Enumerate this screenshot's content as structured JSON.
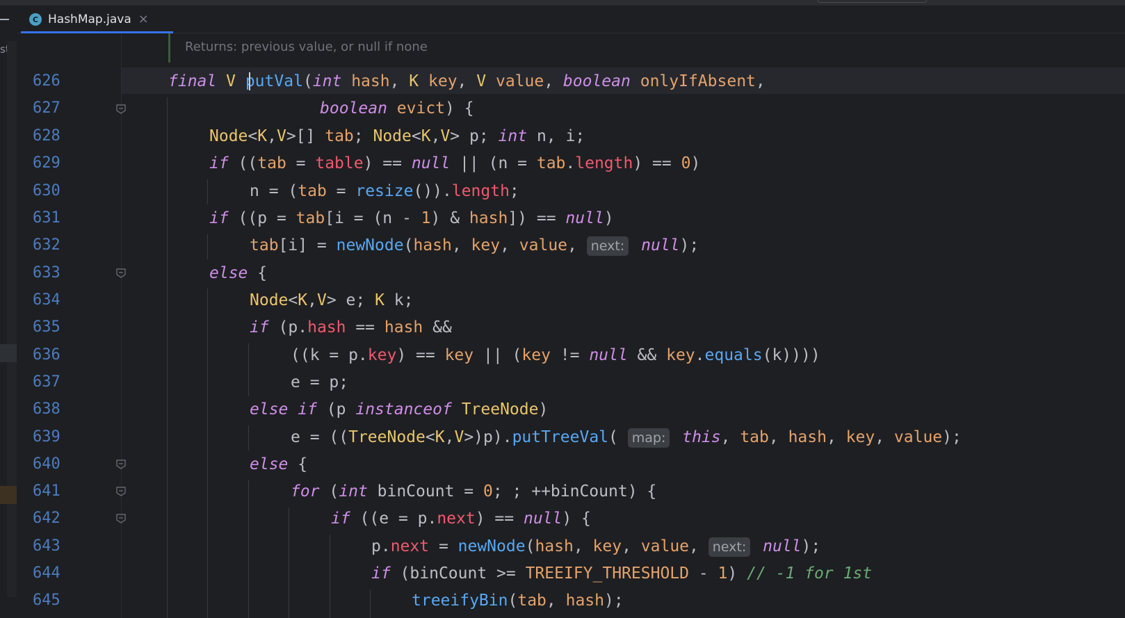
{
  "tabs": [
    {
      "label": "HashMap.java",
      "icon": "java-class-icon",
      "icon_letter": "C",
      "close": "×"
    }
  ],
  "left_strip": {
    "text": "stal"
  },
  "editor": {
    "doc_hint": "Returns: previous value, or null if none",
    "lines": [
      {
        "num": "626",
        "text": "final V putVal(int hash, K key, V value, boolean onlyIfAbsent,"
      },
      {
        "num": "627",
        "text": "boolean evict) {"
      },
      {
        "num": "628",
        "text": "Node<K,V>[] tab; Node<K,V> p; int n, i;"
      },
      {
        "num": "629",
        "text": "if ((tab = table) == null || (n = tab.length) == 0)"
      },
      {
        "num": "630",
        "text": "n = (tab = resize()).length;"
      },
      {
        "num": "631",
        "text": "if ((p = tab[i = (n - 1) & hash]) == null)"
      },
      {
        "num": "632",
        "text": "tab[i] = newNode(hash, key, value, next: null);"
      },
      {
        "num": "633",
        "text": "else {"
      },
      {
        "num": "634",
        "text": "Node<K,V> e; K k;"
      },
      {
        "num": "635",
        "text": "if (p.hash == hash &&"
      },
      {
        "num": "636",
        "text": "((k = p.key) == key || (key != null && key.equals(k))))"
      },
      {
        "num": "637",
        "text": "e = p;"
      },
      {
        "num": "638",
        "text": "else if (p instanceof TreeNode)"
      },
      {
        "num": "639",
        "text": "e = ((TreeNode<K,V>)p).putTreeVal( map: this, tab, hash, key, value);"
      },
      {
        "num": "640",
        "text": "else {"
      },
      {
        "num": "641",
        "text": "for (int binCount = 0; ; ++binCount) {"
      },
      {
        "num": "642",
        "text": "if ((e = p.next) == null) {"
      },
      {
        "num": "643",
        "text": "p.next = newNode(hash, key, value, next: null);"
      },
      {
        "num": "644",
        "text": "if (binCount >= TREEIFY_THRESHOLD - 1) // -1 for 1st"
      },
      {
        "num": "645",
        "text": "treeifyBin(tab, hash);"
      }
    ]
  },
  "colors": {
    "background": "#1e1f22",
    "keyword": "#cf8ee9",
    "type": "#e9c66b",
    "function": "#56a8f5",
    "parameter": "#e5a36a",
    "field": "#ef596f",
    "comment": "#6aab73",
    "line_number": "#4b7cc1"
  }
}
